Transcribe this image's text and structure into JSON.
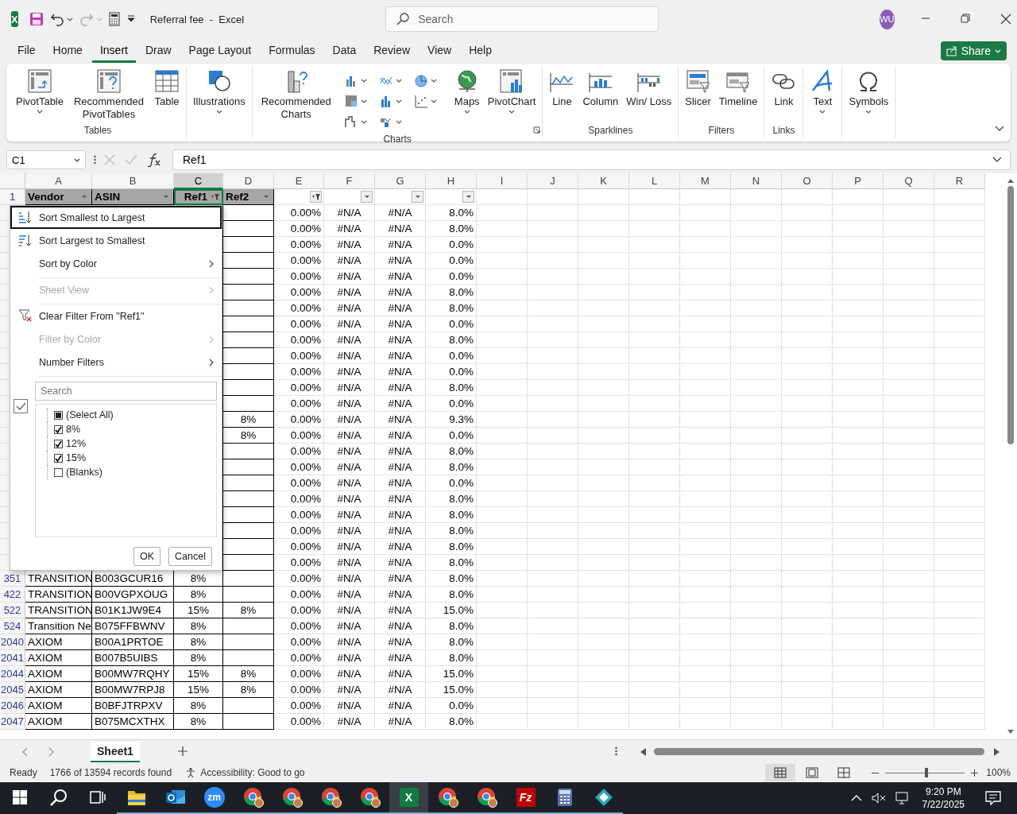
{
  "title_bar": {
    "app_letter": "X",
    "document_title": "Referral fee  -  Excel",
    "search_placeholder": "Search",
    "avatar_initials": "WU"
  },
  "menu_tabs": [
    {
      "label": "File",
      "selected": false
    },
    {
      "label": "Home",
      "selected": false
    },
    {
      "label": "Insert",
      "selected": true
    },
    {
      "label": "Draw",
      "selected": false
    },
    {
      "label": "Page Layout",
      "selected": false
    },
    {
      "label": "Formulas",
      "selected": false
    },
    {
      "label": "Data",
      "selected": false
    },
    {
      "label": "Review",
      "selected": false
    },
    {
      "label": "View",
      "selected": false
    },
    {
      "label": "Help",
      "selected": false
    }
  ],
  "share_button": "Share",
  "ribbon_groups": [
    {
      "label": "Tables",
      "launcher": false,
      "items": [
        {
          "kind": "large",
          "label": "PivotTable",
          "dropdown": true
        },
        {
          "kind": "large",
          "label": "Recommended PivotTables",
          "dropdown": false
        },
        {
          "kind": "large",
          "label": "Table",
          "dropdown": false
        }
      ]
    },
    {
      "launcher": false,
      "items": [
        {
          "kind": "large",
          "label": "Illustrations",
          "dropdown": true
        }
      ]
    },
    {
      "label": "Charts",
      "launcher": true,
      "items": [
        {
          "kind": "large",
          "label": "Recommended Charts",
          "dropdown": false
        },
        {
          "kind": "gallery"
        },
        {
          "kind": "large",
          "label": "Maps",
          "dropdown": true
        },
        {
          "kind": "large",
          "label": "PivotChart",
          "dropdown": true
        }
      ]
    },
    {
      "label": "Sparklines",
      "launcher": false,
      "items": [
        {
          "kind": "large",
          "label": "Line",
          "dropdown": false
        },
        {
          "kind": "large",
          "label": "Column",
          "dropdown": false
        },
        {
          "kind": "large",
          "label": "Win/ Loss",
          "dropdown": false
        }
      ]
    },
    {
      "label": "Filters",
      "launcher": false,
      "items": [
        {
          "kind": "large",
          "label": "Slicer",
          "dropdown": false
        },
        {
          "kind": "large",
          "label": "Timeline",
          "dropdown": false
        }
      ]
    },
    {
      "label": "Links",
      "launcher": false,
      "items": [
        {
          "kind": "large",
          "label": "Link",
          "dropdown": false
        }
      ]
    },
    {
      "launcher": false,
      "items": [
        {
          "kind": "large",
          "label": "Text",
          "dropdown": true
        }
      ]
    },
    {
      "launcher": false,
      "items": [
        {
          "kind": "large",
          "label": "Symbols",
          "dropdown": true
        }
      ]
    }
  ],
  "formula_bar": {
    "name_box": "C1",
    "formula": "Ref1"
  },
  "columns": [
    {
      "letter": "A",
      "selected": false
    },
    {
      "letter": "B",
      "selected": false
    },
    {
      "letter": "C",
      "selected": true
    },
    {
      "letter": "D",
      "selected": false
    },
    {
      "letter": "E",
      "selected": false
    },
    {
      "letter": "F",
      "selected": false
    },
    {
      "letter": "G",
      "selected": false
    },
    {
      "letter": "H",
      "selected": false
    },
    {
      "letter": "I",
      "selected": false
    },
    {
      "letter": "J",
      "selected": false
    },
    {
      "letter": "K",
      "selected": false
    },
    {
      "letter": "L",
      "selected": false
    },
    {
      "letter": "M",
      "selected": false
    },
    {
      "letter": "N",
      "selected": false
    },
    {
      "letter": "O",
      "selected": false
    },
    {
      "letter": "P",
      "selected": false
    },
    {
      "letter": "Q",
      "selected": false
    },
    {
      "letter": "R",
      "selected": false
    }
  ],
  "header_row": {
    "row_number": "1",
    "cells": [
      {
        "text": "Vendor",
        "filtered": false
      },
      {
        "text": "ASIN",
        "filtered": false
      },
      {
        "text": "Ref1",
        "filtered": true
      },
      {
        "text": "Ref2",
        "filtered": false
      },
      {
        "filtered": true
      },
      {
        "filtered": false
      },
      {
        "filtered": false
      },
      {
        "filtered": false
      }
    ]
  },
  "rows": [
    {
      "cells": [
        null,
        null,
        null,
        null,
        "0.00%",
        "#N/A",
        "#N/A",
        "8.0%"
      ]
    },
    {
      "cells": [
        null,
        null,
        null,
        null,
        "0.00%",
        "#N/A",
        "#N/A",
        "8.0%"
      ]
    },
    {
      "cells": [
        null,
        null,
        null,
        null,
        "0.00%",
        "#N/A",
        "#N/A",
        "0.0%"
      ]
    },
    {
      "cells": [
        null,
        null,
        null,
        null,
        "0.00%",
        "#N/A",
        "#N/A",
        "0.0%"
      ]
    },
    {
      "cells": [
        null,
        null,
        null,
        null,
        "0.00%",
        "#N/A",
        "#N/A",
        "0.0%"
      ]
    },
    {
      "cells": [
        null,
        null,
        null,
        null,
        "0.00%",
        "#N/A",
        "#N/A",
        "8.0%"
      ]
    },
    {
      "cells": [
        null,
        null,
        null,
        null,
        "0.00%",
        "#N/A",
        "#N/A",
        "8.0%"
      ]
    },
    {
      "cells": [
        null,
        null,
        null,
        null,
        "0.00%",
        "#N/A",
        "#N/A",
        "0.0%"
      ]
    },
    {
      "cells": [
        null,
        null,
        null,
        null,
        "0.00%",
        "#N/A",
        "#N/A",
        "8.0%"
      ]
    },
    {
      "cells": [
        null,
        null,
        null,
        null,
        "0.00%",
        "#N/A",
        "#N/A",
        "0.0%"
      ]
    },
    {
      "cells": [
        null,
        null,
        null,
        null,
        "0.00%",
        "#N/A",
        "#N/A",
        "0.0%"
      ]
    },
    {
      "cells": [
        null,
        null,
        null,
        null,
        "0.00%",
        "#N/A",
        "#N/A",
        "8.0%"
      ]
    },
    {
      "cells": [
        null,
        null,
        null,
        null,
        "0.00%",
        "#N/A",
        "#N/A",
        "0.0%"
      ]
    },
    {
      "cells": [
        null,
        null,
        null,
        "8%",
        "0.00%",
        "#N/A",
        "#N/A",
        "9.3%"
      ]
    },
    {
      "cells": [
        null,
        null,
        null,
        "8%",
        "0.00%",
        "#N/A",
        "#N/A",
        "0.0%"
      ]
    },
    {
      "cells": [
        null,
        null,
        null,
        null,
        "0.00%",
        "#N/A",
        "#N/A",
        "8.0%"
      ]
    },
    {
      "cells": [
        null,
        null,
        null,
        null,
        "0.00%",
        "#N/A",
        "#N/A",
        "8.0%"
      ]
    },
    {
      "cells": [
        null,
        null,
        null,
        null,
        "0.00%",
        "#N/A",
        "#N/A",
        "0.0%"
      ]
    },
    {
      "cells": [
        null,
        null,
        null,
        null,
        "0.00%",
        "#N/A",
        "#N/A",
        "8.0%"
      ]
    },
    {
      "cells": [
        null,
        null,
        null,
        null,
        "0.00%",
        "#N/A",
        "#N/A",
        "8.0%"
      ]
    },
    {
      "cells": [
        null,
        null,
        null,
        null,
        "0.00%",
        "#N/A",
        "#N/A",
        "8.0%"
      ]
    },
    {
      "cells": [
        null,
        null,
        null,
        null,
        "0.00%",
        "#N/A",
        "#N/A",
        "8.0%"
      ]
    },
    {
      "cells": [
        null,
        null,
        null,
        null,
        "0.00%",
        "#N/A",
        "#N/A",
        "8.0%"
      ]
    },
    {
      "row_number": "351",
      "cells": [
        "TRANSITION",
        "B003GCUR16",
        "8%",
        null,
        "0.00%",
        "#N/A",
        "#N/A",
        "8.0%"
      ]
    },
    {
      "row_number": "422",
      "cells": [
        "TRANSITION",
        "B00VGPXOUG",
        "8%",
        null,
        "0.00%",
        "#N/A",
        "#N/A",
        "8.0%"
      ]
    },
    {
      "row_number": "522",
      "cells": [
        "TRANSITION",
        "B01K1JW9E4",
        "15%",
        "8%",
        "0.00%",
        "#N/A",
        "#N/A",
        "15.0%"
      ]
    },
    {
      "row_number": "524",
      "cells": [
        "Transition Ne",
        "B075FFBWNV",
        "8%",
        null,
        "0.00%",
        "#N/A",
        "#N/A",
        "8.0%"
      ]
    },
    {
      "row_number": "2040",
      "cells": [
        "AXIOM",
        "B00A1PRTOE",
        "8%",
        null,
        "0.00%",
        "#N/A",
        "#N/A",
        "8.0%"
      ]
    },
    {
      "row_number": "2041",
      "cells": [
        "AXIOM",
        "B007B5UIBS",
        "8%",
        null,
        "0.00%",
        "#N/A",
        "#N/A",
        "8.0%"
      ]
    },
    {
      "row_number": "2044",
      "cells": [
        "AXIOM",
        "B00MW7RQHY",
        "15%",
        "8%",
        "0.00%",
        "#N/A",
        "#N/A",
        "15.0%"
      ]
    },
    {
      "row_number": "2045",
      "cells": [
        "AXIOM",
        "B00MW7RPJ8",
        "15%",
        "8%",
        "0.00%",
        "#N/A",
        "#N/A",
        "15.0%"
      ]
    },
    {
      "row_number": "2046",
      "cells": [
        "AXIOM",
        "B0BFJTRPXV",
        "8%",
        null,
        "0.00%",
        "#N/A",
        "#N/A",
        "0.0%"
      ]
    },
    {
      "row_number": "2047",
      "cells": [
        "AXIOM",
        "B075MCXTHX",
        "8%",
        null,
        "0.00%",
        "#N/A",
        "#N/A",
        "8.0%"
      ]
    }
  ],
  "filter_popup": {
    "menu": [
      {
        "kind": "ascending",
        "label": "Sort Smallest to Largest",
        "disabled": false,
        "submenu": false,
        "selected": true,
        "separator_after": false
      },
      {
        "kind": "descending",
        "label": "Sort Largest to Smallest",
        "disabled": false,
        "submenu": false,
        "selected": false,
        "separator_after": false
      },
      {
        "kind": "plain",
        "label": "Sort by Color",
        "disabled": false,
        "submenu": true,
        "selected": false,
        "separator_after": true
      },
      {
        "kind": "plain",
        "label": "Sheet View",
        "disabled": true,
        "submenu": true,
        "selected": false,
        "separator_after": true
      },
      {
        "kind": "clearfilter",
        "label": "Clear Filter From \"Ref1\"",
        "disabled": false,
        "submenu": false,
        "selected": false,
        "separator_after": false
      },
      {
        "kind": "plain",
        "label": "Filter by Color",
        "disabled": true,
        "submenu": true,
        "selected": false,
        "separator_after": false
      },
      {
        "kind": "plain",
        "label": "Number Filters",
        "disabled": false,
        "submenu": true,
        "selected": false,
        "separator_after": true
      }
    ],
    "search_placeholder": "Search",
    "values": [
      {
        "kind": "selectall",
        "label": "(Select All)",
        "checked": false
      },
      {
        "kind": "value",
        "label": "8%",
        "checked": true
      },
      {
        "kind": "value",
        "label": "12%",
        "checked": true
      },
      {
        "kind": "value",
        "label": "15%",
        "checked": true
      },
      {
        "kind": "value",
        "label": "(Blanks)",
        "checked": false
      }
    ],
    "buttons": [
      "OK",
      "Cancel"
    ]
  },
  "sheet_tabs": [
    {
      "label": "Sheet1",
      "selected": true
    }
  ],
  "status_bar": {
    "mode": "Ready",
    "records": "1766 of 13594 records found",
    "accessibility": "Accessibility: Good to go",
    "views": [
      {
        "kind": "normal",
        "selected": true
      },
      {
        "kind": "pagelayout",
        "selected": false
      },
      {
        "kind": "pagebreak",
        "selected": false
      }
    ],
    "zoom_slider": {
      "level": 0.5
    },
    "zoom": "100%"
  },
  "taskbar": {
    "apps": [
      {
        "kind": "start",
        "running": false,
        "active": false
      },
      {
        "kind": "search",
        "running": false,
        "active": false
      },
      {
        "kind": "taskview",
        "running": false,
        "active": false
      },
      {
        "kind": "folder",
        "running": true,
        "active": false
      },
      {
        "kind": "outlook",
        "running": true,
        "active": false
      },
      {
        "kind": "zoom",
        "text": "zm",
        "running": true,
        "active": false
      },
      {
        "kind": "chrome",
        "running": true,
        "active": false
      },
      {
        "kind": "chrome",
        "running": true,
        "active": false
      },
      {
        "kind": "chrome",
        "running": true,
        "active": false
      },
      {
        "kind": "chrome",
        "running": true,
        "active": false
      },
      {
        "kind": "excel",
        "text": "X",
        "running": true,
        "active": true
      },
      {
        "kind": "chrome",
        "running": true,
        "active": false
      },
      {
        "kind": "chrome",
        "running": true,
        "active": false
      },
      {
        "kind": "filezilla",
        "text": "Fz",
        "running": true,
        "active": false
      },
      {
        "kind": "calculator",
        "running": true,
        "active": false
      },
      {
        "kind": "app",
        "running": true,
        "active": false
      }
    ],
    "time": "9:20 PM",
    "date": "7/22/2025"
  }
}
